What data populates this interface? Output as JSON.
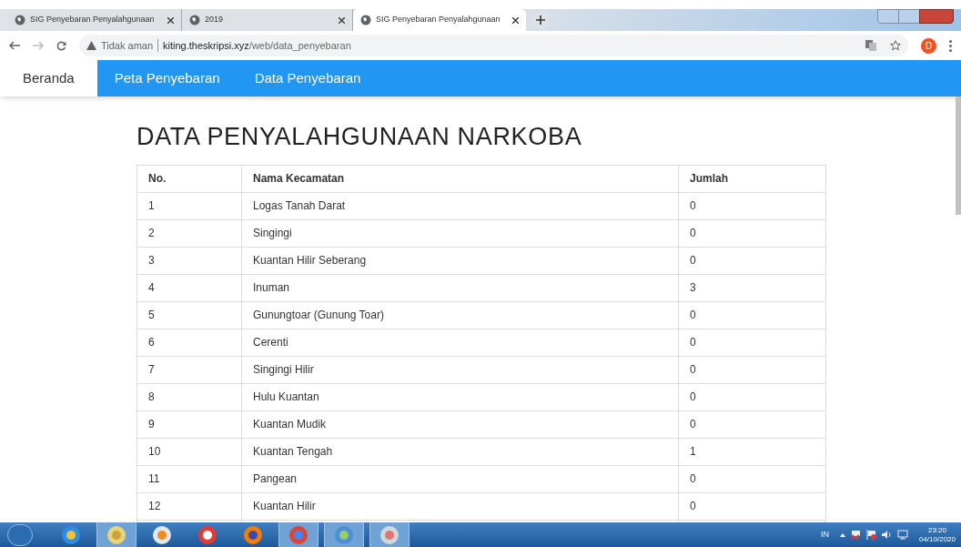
{
  "browser": {
    "tabs": [
      {
        "title": "SIG Penyebaran Penyalahgunaan",
        "selected": false
      },
      {
        "title": "2019",
        "selected": false
      },
      {
        "title": "SIG Penyebaran Penyalahgunaan",
        "selected": true
      }
    ],
    "security": "Tidak aman",
    "url_host": "kiting.theskripsi.xyz",
    "url_path": "/web/data_penyebaran",
    "profile": "D"
  },
  "nav": [
    {
      "label": "Beranda",
      "selected": true
    },
    {
      "label": "Peta Penyebaran",
      "selected": false
    },
    {
      "label": "Data Penyebaran",
      "selected": false
    }
  ],
  "heading": "DATA PENYALAHGUNAAN NARKOBA",
  "table": {
    "columns": [
      "No.",
      "Nama Kecamatan",
      "Jumlah"
    ],
    "rows": [
      [
        "1",
        "Logas Tanah Darat",
        "0"
      ],
      [
        "2",
        "Singingi",
        "0"
      ],
      [
        "3",
        "Kuantan Hilir Seberang",
        "0"
      ],
      [
        "4",
        "Inuman",
        "3"
      ],
      [
        "5",
        "Gunungtoar (Gunung Toar)",
        "0"
      ],
      [
        "6",
        "Cerenti",
        "0"
      ],
      [
        "7",
        "Singingi Hilir",
        "0"
      ],
      [
        "8",
        "Hulu Kuantan",
        "0"
      ],
      [
        "9",
        "Kuantan Mudik",
        "0"
      ],
      [
        "10",
        "Kuantan Tengah",
        "1"
      ],
      [
        "11",
        "Pangean",
        "0"
      ],
      [
        "12",
        "Kuantan Hilir",
        "0"
      ]
    ]
  },
  "taskbar": {
    "language": "IN",
    "time": "23:20",
    "date": "04/10/2020"
  }
}
